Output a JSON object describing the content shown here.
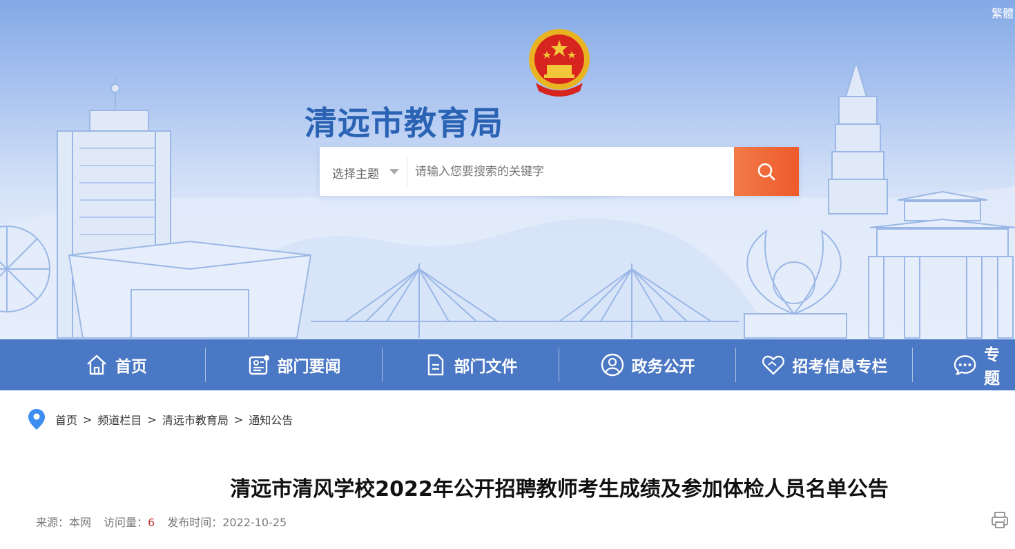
{
  "header": {
    "lang_toggle": "繁體",
    "site_title": "清远市教育局"
  },
  "search": {
    "topic_label": "选择主题",
    "placeholder": "请输入您要搜索的关键字"
  },
  "nav": {
    "items": [
      {
        "label": "首页",
        "icon": "home-icon"
      },
      {
        "label": "部门要闻",
        "icon": "news-icon"
      },
      {
        "label": "部门文件",
        "icon": "document-icon"
      },
      {
        "label": "政务公开",
        "icon": "user-circle-icon"
      },
      {
        "label": "招考信息专栏",
        "icon": "heart-handshake-icon"
      },
      {
        "label": "专题",
        "icon": "chat-icon"
      }
    ]
  },
  "breadcrumb": {
    "items": [
      "首页",
      "频道栏目",
      "清远市教育局",
      "通知公告"
    ],
    "separator": ">"
  },
  "article": {
    "title": "清远市清风学校2022年公开招聘教师考生成绩及参加体检人员名单公告",
    "source_label": "来源：",
    "source": "本网",
    "views_label": "访问量：",
    "views": "6",
    "date_label": "发布时间：",
    "date": "2022-10-25"
  },
  "colors": {
    "nav_bg": "#4b78c4",
    "title_blue": "#2b63b4",
    "search_button": "#ee5a2b",
    "pin_blue": "#3d8ef0"
  }
}
